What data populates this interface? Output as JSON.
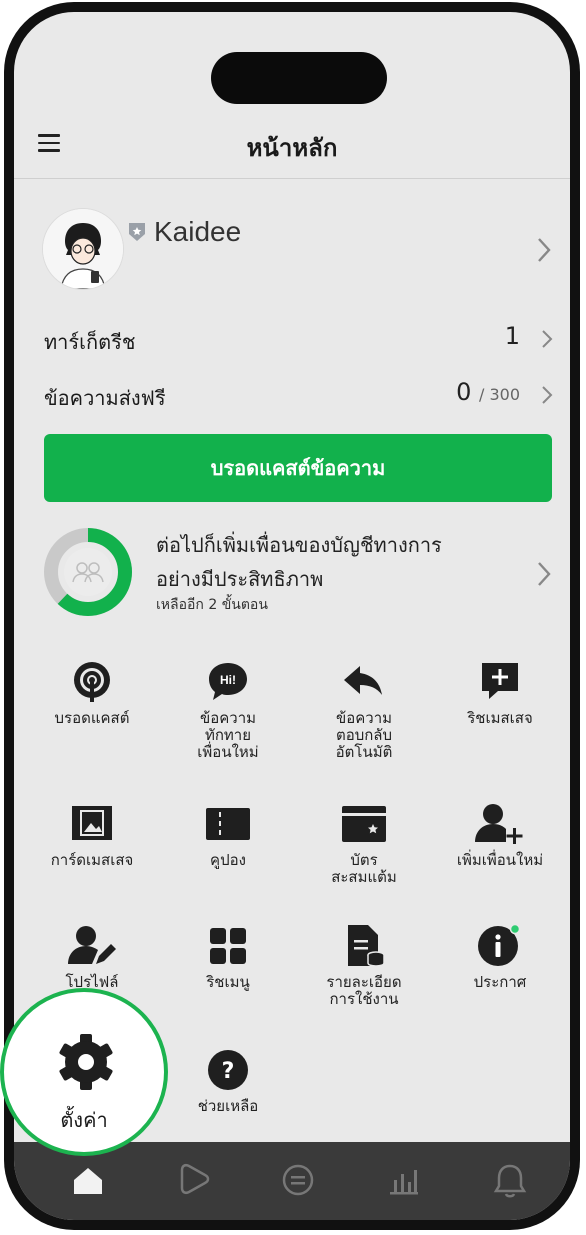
{
  "header": {
    "title": "หน้าหลัก"
  },
  "profile": {
    "name": "Kaidee"
  },
  "rows": [
    {
      "label": "ทาร์เก็ตรีช",
      "value": "1",
      "suffix": ""
    },
    {
      "label": "ข้อความส่งฟรี",
      "value": "0",
      "suffix": "/ 300"
    }
  ],
  "broadcast_button": "บรอดแคสต์ข้อความ",
  "progress": {
    "title": "ต่อไปก็เพิ่มเพื่อนของบัญชีทางการอย่างมีประสิทธิภาพ",
    "subtitle": "เหลืออีก 2 ขั้นตอน",
    "fraction": 0.62
  },
  "grid": [
    {
      "label": "บรอดแคสต์",
      "icon": "broadcast-icon"
    },
    {
      "label": "ข้อความ\nทักทาย\nเพื่อนใหม่",
      "icon": "greeting-icon"
    },
    {
      "label": "ข้อความ\nตอบกลับ\nอัตโนมัติ",
      "icon": "reply-icon"
    },
    {
      "label": "ริชเมสเสจ",
      "icon": "rich-message-icon"
    },
    {
      "label": "การ์ดเมสเสจ",
      "icon": "card-message-icon"
    },
    {
      "label": "คูปอง",
      "icon": "coupon-icon"
    },
    {
      "label": "บัตร\nสะสมแต้ม",
      "icon": "reward-card-icon"
    },
    {
      "label": "เพิ่มเพื่อนใหม่",
      "icon": "add-friend-icon"
    },
    {
      "label": "โปรไฟล์",
      "icon": "profile-icon"
    },
    {
      "label": "ริชเมนู",
      "icon": "rich-menu-icon"
    },
    {
      "label": "รายละเอียด\nการใช้งาน",
      "icon": "usage-icon"
    },
    {
      "label": "ประกาศ",
      "icon": "info-icon"
    },
    {
      "label": "ช่วยเหลือ",
      "icon": "help-icon"
    }
  ],
  "settings": {
    "label": "ตั้งค่า",
    "icon": "gear-icon"
  },
  "colors": {
    "accent": "#12b14c",
    "tabbar": "#3a3a3a",
    "notify_dot": "#2ecc71"
  },
  "tabs": [
    "home-icon",
    "play-icon",
    "chat-icon",
    "insight-icon",
    "bell-icon"
  ]
}
